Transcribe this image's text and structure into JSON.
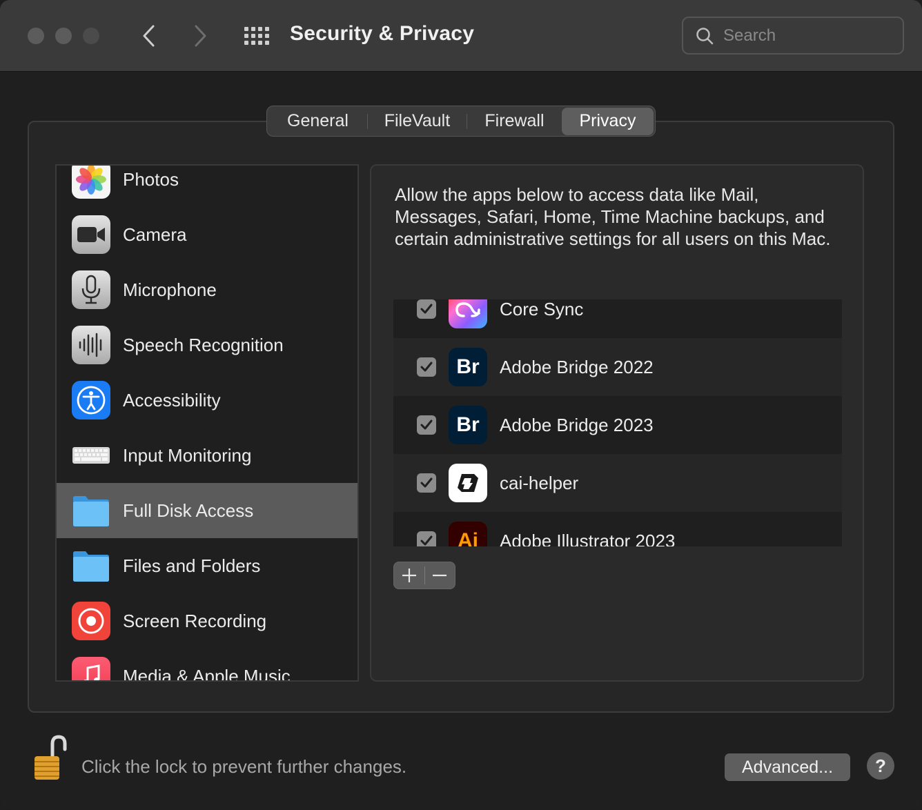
{
  "window": {
    "title": "Security & Privacy",
    "search_placeholder": "Search"
  },
  "tabs": [
    {
      "label": "General",
      "selected": false
    },
    {
      "label": "FileVault",
      "selected": false
    },
    {
      "label": "Firewall",
      "selected": false
    },
    {
      "label": "Privacy",
      "selected": true
    }
  ],
  "sidebar": {
    "items": [
      {
        "label": "Photos",
        "icon": "photos-icon"
      },
      {
        "label": "Camera",
        "icon": "camera-icon"
      },
      {
        "label": "Microphone",
        "icon": "microphone-icon"
      },
      {
        "label": "Speech Recognition",
        "icon": "speech-recognition-icon"
      },
      {
        "label": "Accessibility",
        "icon": "accessibility-icon"
      },
      {
        "label": "Input Monitoring",
        "icon": "keyboard-icon"
      },
      {
        "label": "Full Disk Access",
        "icon": "folder-icon",
        "selected": true
      },
      {
        "label": "Files and Folders",
        "icon": "folder-icon"
      },
      {
        "label": "Screen Recording",
        "icon": "screen-recording-icon"
      },
      {
        "label": "Media & Apple Music",
        "icon": "music-icon"
      }
    ]
  },
  "panel": {
    "description": "Allow the apps below to access data like Mail, Messages, Safari, Home, Time Machine backups, and certain administrative settings for all users on this Mac.",
    "apps": [
      {
        "name": "Core Sync",
        "checked": true,
        "icon": "creative-cloud-icon"
      },
      {
        "name": "Adobe Bridge 2022",
        "checked": true,
        "icon": "adobe-bridge-icon",
        "icon_text": "Br"
      },
      {
        "name": "Adobe Bridge 2023",
        "checked": true,
        "icon": "adobe-bridge-icon",
        "icon_text": "Br"
      },
      {
        "name": "cai-helper",
        "checked": true,
        "icon": "cai-helper-icon"
      },
      {
        "name": "Adobe Illustrator 2023",
        "checked": true,
        "icon": "adobe-illustrator-icon",
        "icon_text": "Ai"
      }
    ]
  },
  "footer": {
    "lock_text": "Click the lock to prevent further changes.",
    "advanced_label": "Advanced...",
    "help_label": "?"
  },
  "colors": {
    "bridge_bg": "#001e36",
    "bridge_text": "#ffffff",
    "illustrator_bg": "#330000",
    "illustrator_text": "#ff9a00",
    "accessibility_blue": "#1a7cf5",
    "folder_blue": "#5ab4f2",
    "screen_recording_red": "#f0433a"
  }
}
